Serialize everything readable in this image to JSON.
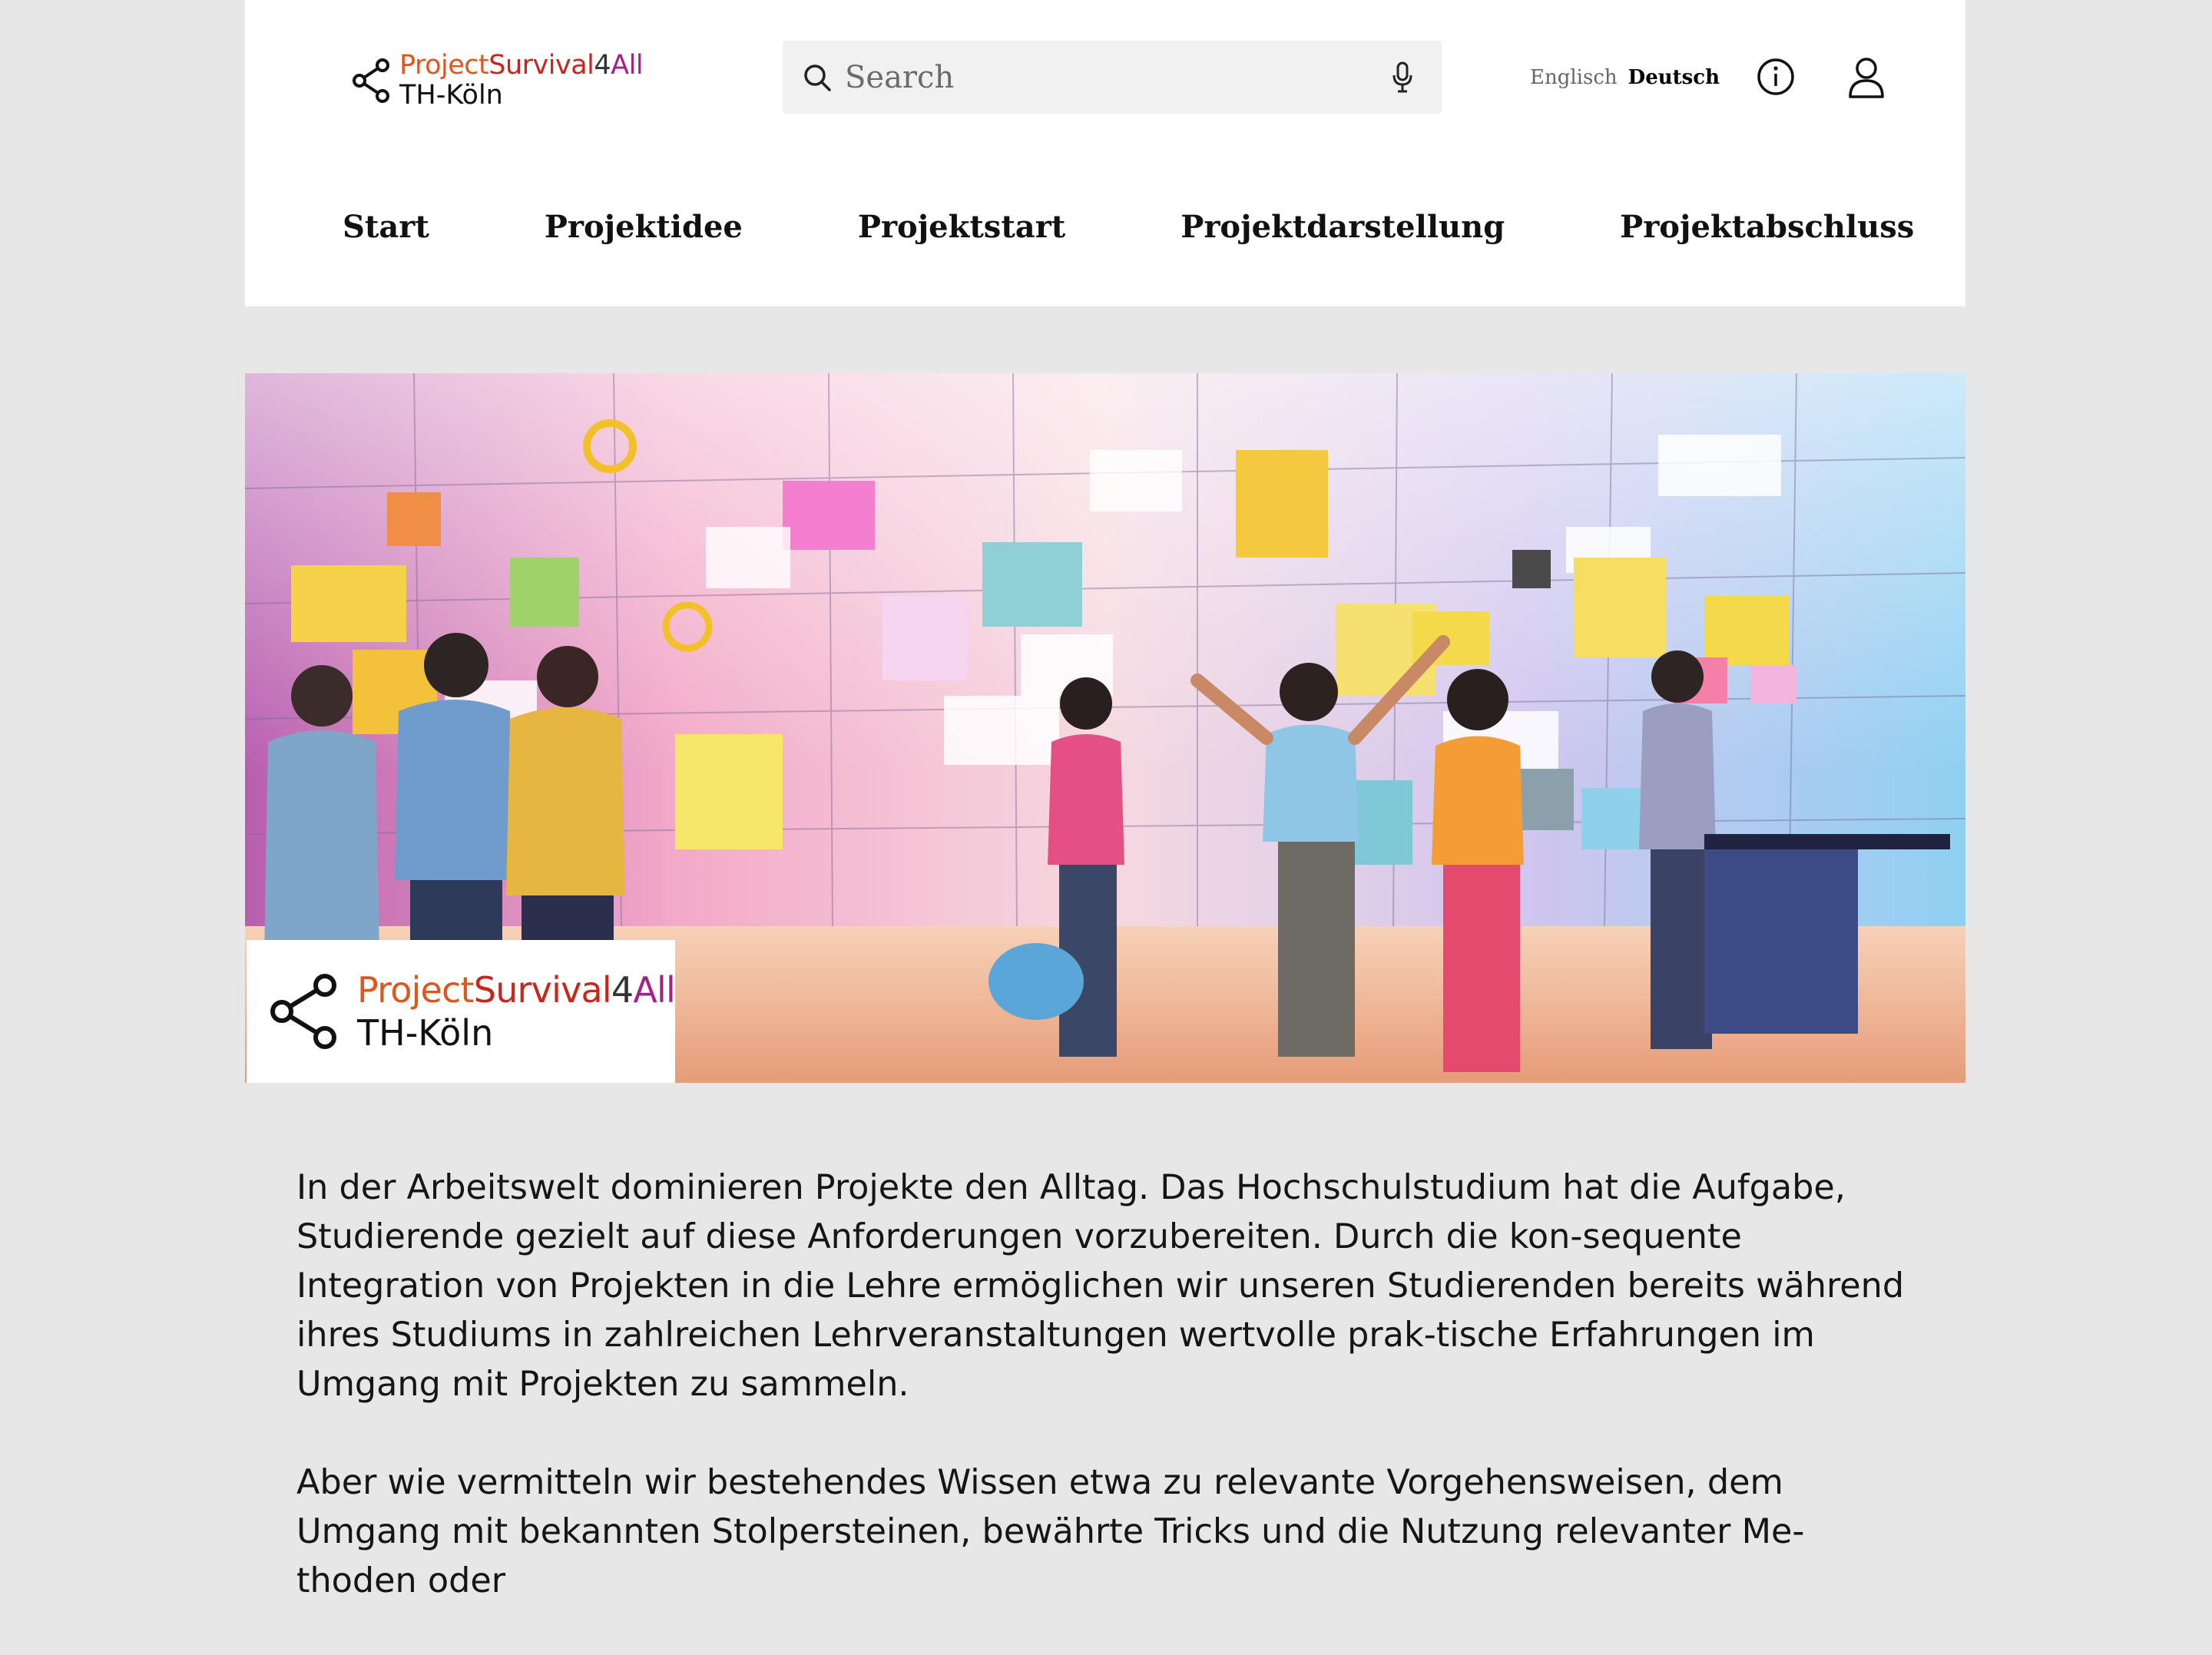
{
  "brand": {
    "part1": "Project",
    "part2": "Survival",
    "part3": "4",
    "part4": "All",
    "line2": "TH-Köln",
    "colors": {
      "project": "#e0561c",
      "survival": "#c8261b",
      "four": "#333333",
      "all": "#a3218a"
    }
  },
  "search": {
    "placeholder": "Search",
    "icon": "search-icon",
    "voice_icon": "microphone-icon"
  },
  "languages": {
    "english": "Englisch",
    "german": "Deutsch",
    "active": "Deutsch"
  },
  "header_icons": {
    "info": "info-icon",
    "account": "user-icon"
  },
  "nav": [
    {
      "label": "Start"
    },
    {
      "label": "Projektidee"
    },
    {
      "label": "Projektstart"
    },
    {
      "label": "Projektdarstellung"
    },
    {
      "label": "Projektabschluss"
    }
  ],
  "hero": {
    "illustration": "team-at-project-board-illustration",
    "badge": {
      "line1_parts": [
        "Project",
        "Survival",
        "4",
        "All"
      ],
      "line2": "TH-Köln"
    }
  },
  "content": {
    "paragraphs": [
      "In der Arbeitswelt dominieren Projekte den Alltag. Das Hochschulstudium hat die Aufgabe, Studierende gezielt auf diese Anforderungen vorzubereiten. Durch die kon-sequente Integration von Projekten in die Lehre ermöglichen wir unseren Studierenden bereits während ihres Studiums in zahlreichen Lehrveranstaltungen wertvolle prak-tische Erfahrungen im Umgang mit Projekten zu sammeln.",
      "Aber wie vermitteln wir bestehendes Wissen etwa zu relevante Vorgehensweisen, dem Umgang mit bekannten Stolpersteinen, bewährte Tricks und die Nutzung relevanter Me-thoden oder"
    ]
  }
}
